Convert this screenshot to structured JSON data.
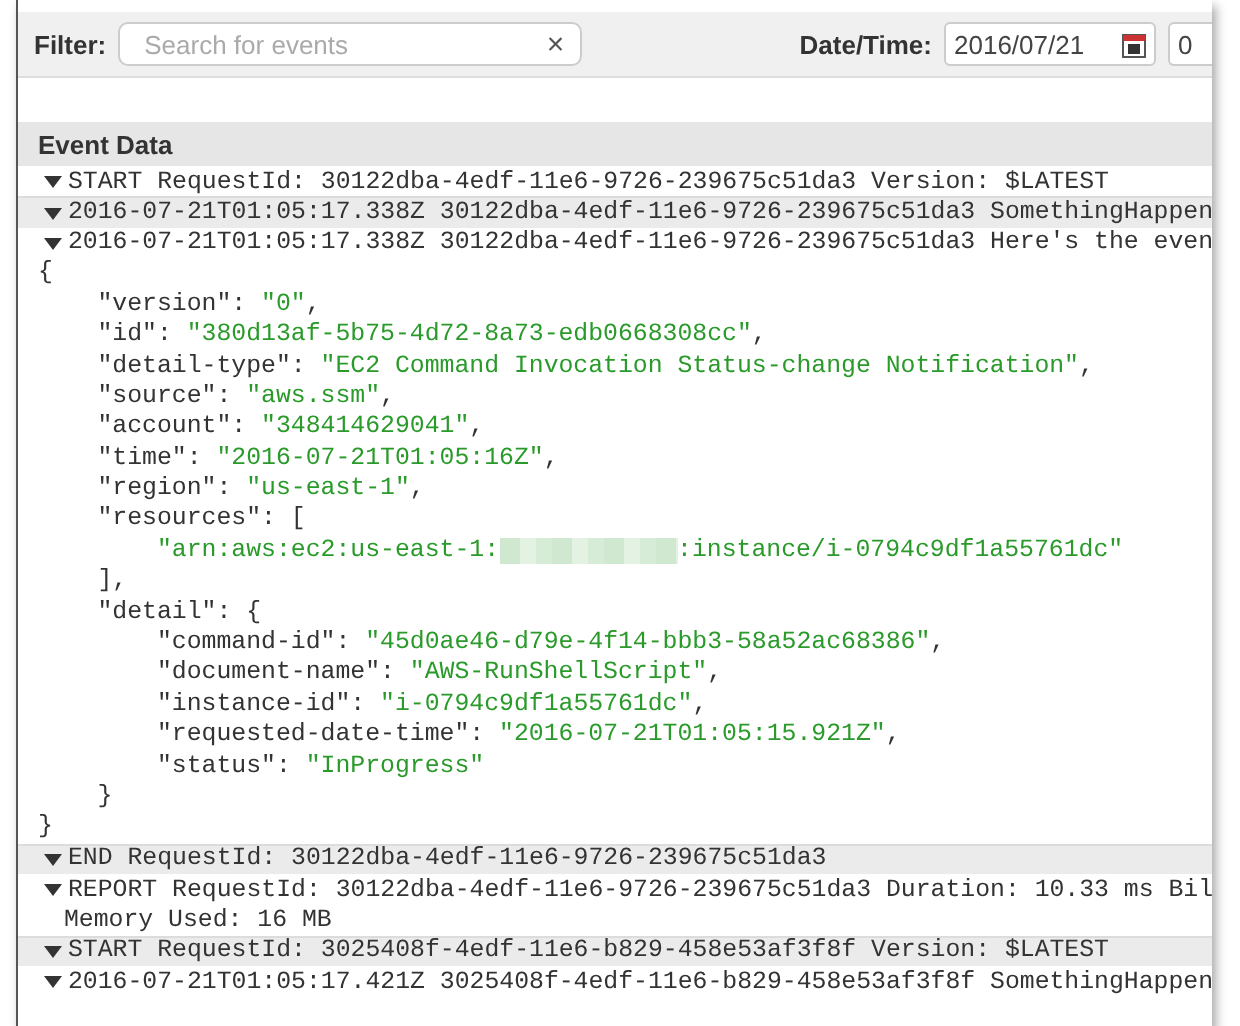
{
  "filter": {
    "label": "Filter:",
    "placeholder": "Search for events",
    "clear": "×"
  },
  "datetime": {
    "label": "Date/Time:",
    "date": "2016/07/21",
    "time": "0"
  },
  "event_data": {
    "title": "Event Data",
    "events": [
      {
        "text": "START RequestId: 30122dba-4edf-11e6-9726-239675c51da3 Version: $LATEST",
        "expanded": true
      },
      {
        "text": "2016-07-21T01:05:17.338Z 30122dba-4edf-11e6-9726-239675c51da3 SomethingHappen",
        "expanded": true
      },
      {
        "text": "2016-07-21T01:05:17.338Z 30122dba-4edf-11e6-9726-239675c51da3 Here's the even",
        "expanded": true,
        "body": [
          [
            {
              "kind": "punct",
              "text": "{"
            }
          ],
          [
            {
              "kind": "key",
              "text": "    \"version\": "
            },
            {
              "kind": "string",
              "text": "\"0\""
            },
            {
              "kind": "punct",
              "text": ","
            }
          ],
          [
            {
              "kind": "key",
              "text": "    \"id\": "
            },
            {
              "kind": "string",
              "text": "\"380d13af-5b75-4d72-8a73-edb0668308cc\""
            },
            {
              "kind": "punct",
              "text": ","
            }
          ],
          [
            {
              "kind": "key",
              "text": "    \"detail-type\": "
            },
            {
              "kind": "string",
              "text": "\"EC2 Command Invocation Status-change Notification\""
            },
            {
              "kind": "punct",
              "text": ","
            }
          ],
          [
            {
              "kind": "key",
              "text": "    \"source\": "
            },
            {
              "kind": "string",
              "text": "\"aws.ssm\""
            },
            {
              "kind": "punct",
              "text": ","
            }
          ],
          [
            {
              "kind": "key",
              "text": "    \"account\": "
            },
            {
              "kind": "string",
              "text": "\"348414629041\""
            },
            {
              "kind": "punct",
              "text": ","
            }
          ],
          [
            {
              "kind": "key",
              "text": "    \"time\": "
            },
            {
              "kind": "string",
              "text": "\"2016-07-21T01:05:16Z\""
            },
            {
              "kind": "punct",
              "text": ","
            }
          ],
          [
            {
              "kind": "key",
              "text": "    \"region\": "
            },
            {
              "kind": "string",
              "text": "\"us-east-1\""
            },
            {
              "kind": "punct",
              "text": ","
            }
          ],
          [
            {
              "kind": "key",
              "text": "    \"resources\": ["
            }
          ],
          [
            {
              "kind": "string",
              "text": "        \"arn:aws:ec2:us-east-1:"
            },
            {
              "kind": "redacted"
            },
            {
              "kind": "string",
              "text": ":instance/i-0794c9df1a55761dc\""
            }
          ],
          [
            {
              "kind": "punct",
              "text": "    ],"
            }
          ],
          [
            {
              "kind": "key",
              "text": "    \"detail\": {"
            }
          ],
          [
            {
              "kind": "key",
              "text": "        \"command-id\": "
            },
            {
              "kind": "string",
              "text": "\"45d0ae46-d79e-4f14-bbb3-58a52ac68386\""
            },
            {
              "kind": "punct",
              "text": ","
            }
          ],
          [
            {
              "kind": "key",
              "text": "        \"document-name\": "
            },
            {
              "kind": "string",
              "text": "\"AWS-RunShellScript\""
            },
            {
              "kind": "punct",
              "text": ","
            }
          ],
          [
            {
              "kind": "key",
              "text": "        \"instance-id\": "
            },
            {
              "kind": "string",
              "text": "\"i-0794c9df1a55761dc\""
            },
            {
              "kind": "punct",
              "text": ","
            }
          ],
          [
            {
              "kind": "key",
              "text": "        \"requested-date-time\": "
            },
            {
              "kind": "string",
              "text": "\"2016-07-21T01:05:15.921Z\""
            },
            {
              "kind": "punct",
              "text": ","
            }
          ],
          [
            {
              "kind": "key",
              "text": "        \"status\": "
            },
            {
              "kind": "string",
              "text": "\"InProgress\""
            }
          ],
          [
            {
              "kind": "punct",
              "text": "    }"
            }
          ],
          [
            {
              "kind": "punct",
              "text": "}"
            }
          ]
        ]
      },
      {
        "text": "END RequestId: 30122dba-4edf-11e6-9726-239675c51da3",
        "expanded": true
      },
      {
        "text": "REPORT RequestId: 30122dba-4edf-11e6-9726-239675c51da3 Duration: 10.33 ms Bil",
        "expanded": true,
        "continuation": "Memory Used: 16 MB"
      },
      {
        "text": "START RequestId: 3025408f-4edf-11e6-b829-458e53af3f8f Version: $LATEST",
        "expanded": true
      },
      {
        "text": "2016-07-21T01:05:17.421Z 3025408f-4edf-11e6-b829-458e53af3f8f SomethingHappen",
        "expanded": true
      }
    ]
  }
}
